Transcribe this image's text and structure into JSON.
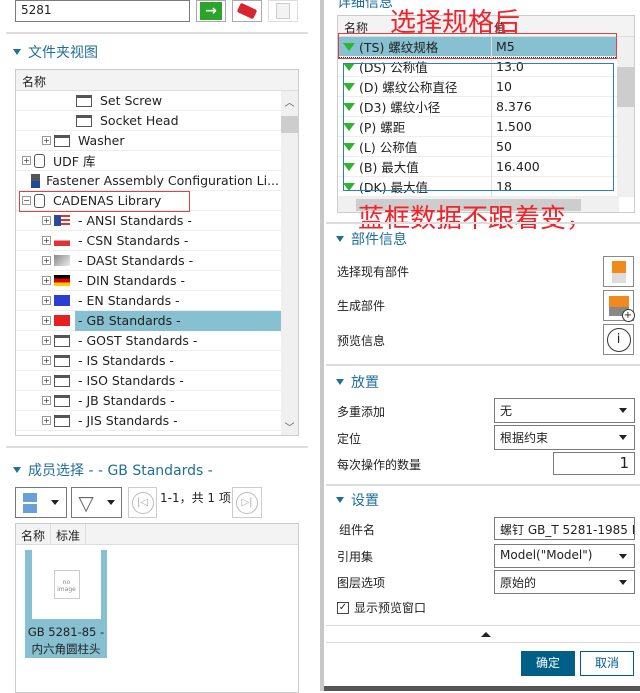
{
  "search": {
    "value": "5281"
  },
  "toolbar": {
    "icons": [
      "go-arrow-icon",
      "eraser-icon",
      "properties-icon"
    ]
  },
  "folder_view": {
    "title": "文件夹视图",
    "column": "名称",
    "items": [
      {
        "label": "Set Screw",
        "icon": "folder-icon"
      },
      {
        "label": "Socket Head",
        "icon": "folder-icon"
      },
      {
        "label": "Washer",
        "icon": "folder-icon"
      },
      {
        "label": "UDF 库",
        "icon": "library-icon"
      },
      {
        "label": "Fastener Assembly Configuration Li...",
        "icon": "assembly-config-icon"
      },
      {
        "label": "CADENAS Library",
        "icon": "library-icon"
      },
      {
        "label": "- ANSI Standards -",
        "icon": "flag-us-icon"
      },
      {
        "label": "- CSN Standards -",
        "icon": "flag-cz-icon"
      },
      {
        "label": "- DASt Standards -",
        "icon": "dast-icon"
      },
      {
        "label": "- DIN Standards -",
        "icon": "flag-de-icon"
      },
      {
        "label": "- EN Standards -",
        "icon": "flag-eu-icon"
      },
      {
        "label": "- GB Standards -",
        "icon": "flag-cn-icon",
        "selected": true
      },
      {
        "label": "- GOST Standards -",
        "icon": "folder-icon"
      },
      {
        "label": "- IS Standards -",
        "icon": "folder-icon"
      },
      {
        "label": "- ISO Standards -",
        "icon": "folder-icon"
      },
      {
        "label": "- JB Standards -",
        "icon": "folder-icon"
      },
      {
        "label": "- JIS Standards -",
        "icon": "folder-icon"
      }
    ]
  },
  "member": {
    "title": "成员选择 - - GB Standards -",
    "paging": "1-1，共 1 项",
    "columns": [
      "名称",
      "标准"
    ],
    "item": {
      "thumb": "no image",
      "label": "GB 5281-85 - 内六角圆柱头"
    }
  },
  "details": {
    "title": "详细信息",
    "columns": [
      "名称",
      "值"
    ],
    "rows": [
      {
        "name": "(TS) 螺纹规格",
        "value": "M5"
      },
      {
        "name": "(DS) 公称值",
        "value": "13.0"
      },
      {
        "name": "(D) 螺纹公称直径",
        "value": "10"
      },
      {
        "name": "(D3) 螺纹小径",
        "value": "8.376"
      },
      {
        "name": "(P) 螺距",
        "value": "1.500"
      },
      {
        "name": "(L) 公称值",
        "value": "50"
      },
      {
        "name": "(B) 最大值",
        "value": "16.400"
      },
      {
        "name": "(DK) 最大值",
        "value": "18"
      }
    ]
  },
  "annotations": {
    "top": "选择规格后",
    "bottom": "蓝框数据不跟着变，"
  },
  "part_info": {
    "title": "部件信息",
    "select_existing": "选择现有部件",
    "generate": "生成部件",
    "preview": "预览信息"
  },
  "placement": {
    "title": "放置",
    "multi_add_label": "多重添加",
    "multi_add_value": "无",
    "position_label": "定位",
    "position_value": "根据约束",
    "count_label": "每次操作的数量",
    "count_value": "1"
  },
  "settings": {
    "title": "设置",
    "component_label": "组件名",
    "component_value": "螺钉 GB_T 5281-1985 M",
    "refset_label": "引用集",
    "refset_value": "Model(\"Model\")",
    "layer_label": "图层选项",
    "layer_value": "原始的",
    "preview_checkbox": "显示预览窗口",
    "preview_checked": true
  },
  "buttons": {
    "ok": "确定",
    "cancel": "取消"
  },
  "colors": {
    "accent": "#1f6f9a",
    "selection": "#87c0d1",
    "primary_button": "#005f87",
    "annotation_red": "#f0232b",
    "annotation_blue": "#2a7fc0"
  }
}
